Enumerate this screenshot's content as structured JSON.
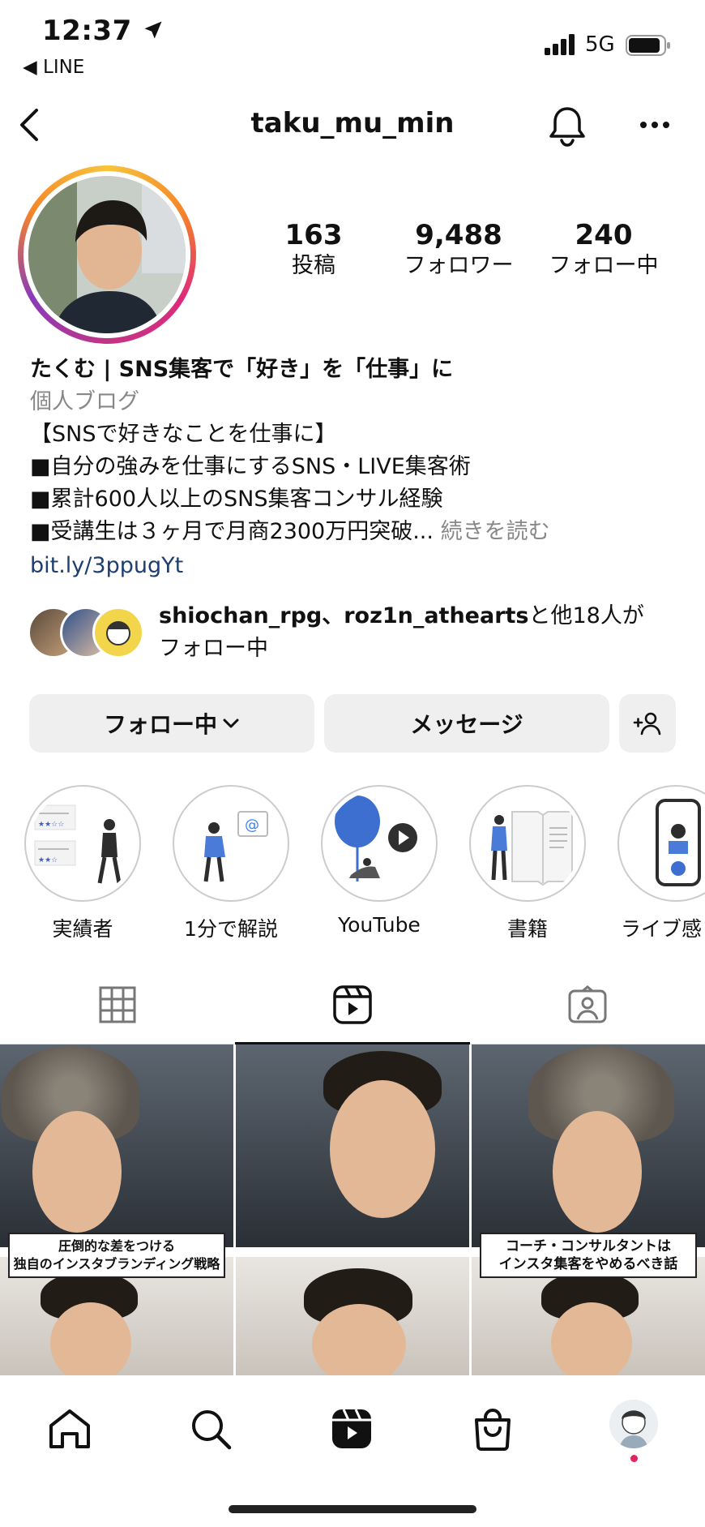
{
  "status_bar": {
    "time": "12:37",
    "back_app": "◀ LINE",
    "network": "5G"
  },
  "header": {
    "username": "taku_mu_min"
  },
  "stats": [
    {
      "value": "163",
      "label": "投稿"
    },
    {
      "value": "9,488",
      "label": "フォロワー"
    },
    {
      "value": "240",
      "label": "フォロー中"
    }
  ],
  "bio": {
    "name": "たくむ | SNS集客で「好き」を「仕事」に",
    "category": "個人ブログ",
    "lines": [
      "【SNSで好きなことを仕事に】",
      "■自分の強みを仕事にするSNS・LIVE集客術",
      "■累計600人以上のSNS集客コンサル経験",
      "■受講生は３ヶ月で月商2300万円突破..."
    ],
    "more": "続きを読む",
    "link": "bit.ly/3ppugYt"
  },
  "followed_by": {
    "users": "shiochan_rpg、roz1n_athearts",
    "rest": "と他18人が",
    "suffix": "フォロー中"
  },
  "buttons": {
    "following": "フォロー中",
    "message": "メッセージ"
  },
  "highlights": [
    {
      "label": "実績者"
    },
    {
      "label": "1分で解説"
    },
    {
      "label": "YouTube"
    },
    {
      "label": "書籍"
    },
    {
      "label": "ライブ感"
    }
  ],
  "reels": [
    {
      "caption": "圧倒的な差をつける\n独自のインスタブランディング戦略"
    },
    {
      "caption": ""
    },
    {
      "caption": "コーチ・コンサルタントは\nインスタ集客をやめるべき話"
    }
  ],
  "colors": {
    "link": "#1d3e6e",
    "secondary_text": "#888888",
    "button_bg": "#efefef",
    "notification_dot": "#e0245e"
  }
}
